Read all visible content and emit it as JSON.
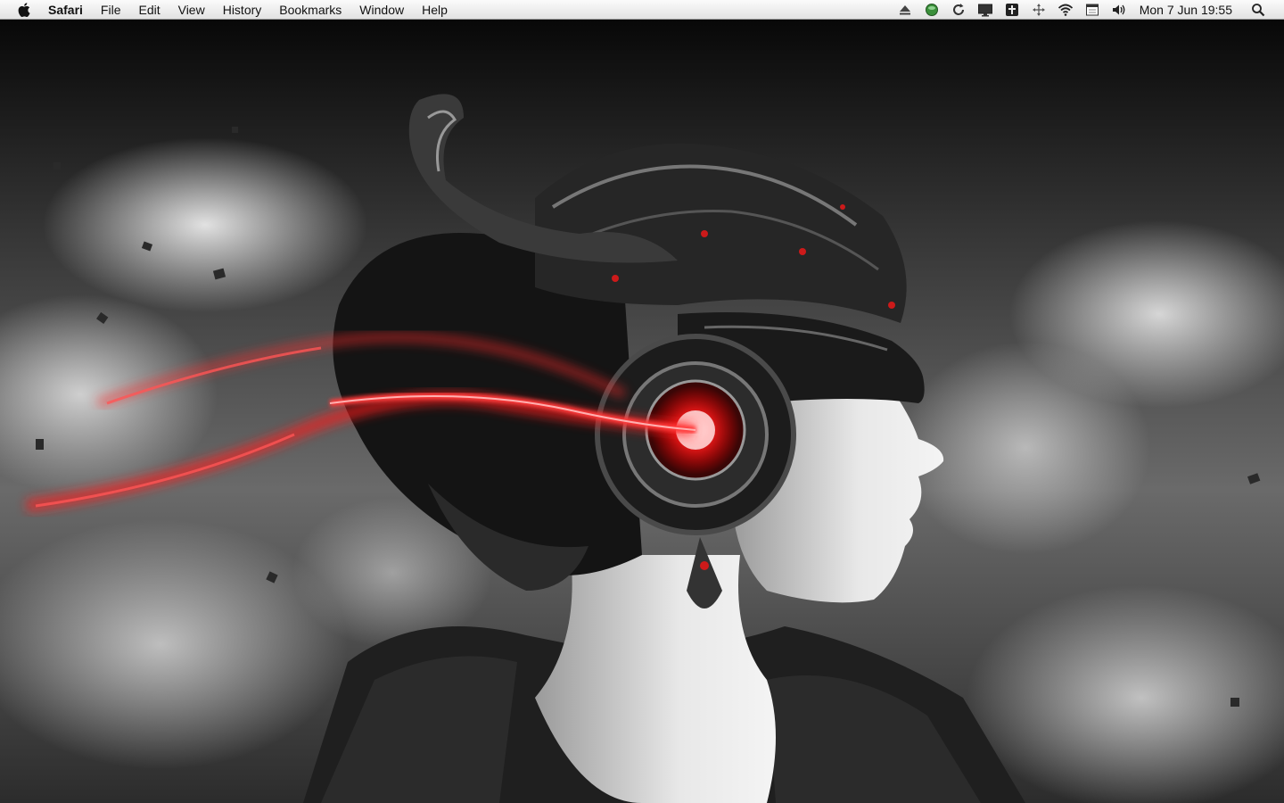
{
  "menubar": {
    "apple_icon": "apple-logo-icon",
    "app_name": "Safari",
    "items": [
      {
        "label": "File"
      },
      {
        "label": "Edit"
      },
      {
        "label": "View"
      },
      {
        "label": "History"
      },
      {
        "label": "Bookmarks"
      },
      {
        "label": "Window"
      },
      {
        "label": "Help"
      }
    ],
    "status_icons": [
      "eject-icon",
      "green-circle-icon",
      "sync-icon",
      "display-icon",
      "app-status-icon",
      "move-arrows-icon",
      "wifi-icon",
      "calendar-icon",
      "volume-icon"
    ],
    "clock": "Mon 7 Jun  19:55",
    "spotlight_icon": "spotlight-search-icon"
  },
  "desktop": {
    "wallpaper": "grayscale woman in ornate helmet with glowing red headphones and music notes, cloudy sky",
    "accent_color": "#ff2222"
  }
}
